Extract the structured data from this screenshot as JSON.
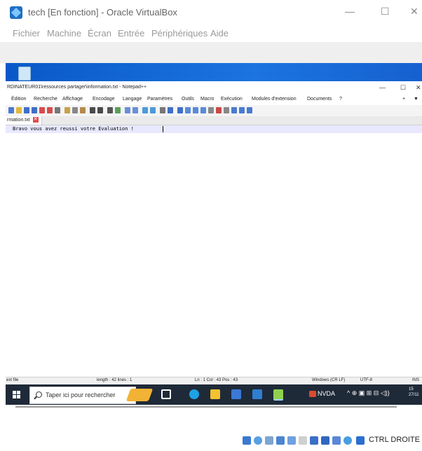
{
  "vbox": {
    "title": "tech [En fonction] - Oracle VirtualBox",
    "minimize": "—",
    "maximize": "☐",
    "close": "✕",
    "menu": [
      "Fichier",
      "Machine",
      "Écran",
      "Entrée",
      "Périphériques",
      "Aide"
    ],
    "host_key": "CTRL DROITE"
  },
  "notepad": {
    "title": "RDINATEUR01\\ressources partager\\information.txt - Notepad++",
    "minimize": "—",
    "maximize": "☐",
    "close": "✕",
    "menu": [
      "Édition",
      "Recherche",
      "Affichage",
      "Encodage",
      "Langage",
      "Paramètres",
      "Outils",
      "Macro",
      "Exécution",
      "Modules d'extension",
      "Documents",
      "?"
    ],
    "menu_extra": [
      "+",
      "▼"
    ],
    "tab": {
      "label": "rmation.txt",
      "close": "✕"
    },
    "content": "Bravo vous avez reussi votre Evaluation !",
    "status": {
      "type": "ext file",
      "length": "length : 42   lines : 1",
      "position": "Ln : 1   Col : 43   Pos : 43",
      "eol": "Windows (CR LF)",
      "encoding": "UTF-8",
      "mode": "INS"
    }
  },
  "taskbar": {
    "search_placeholder": "Taper ici pour rechercher",
    "nvda_label": "NVDA",
    "tray": "^ ⊕ ▣ ⊞ ⊟ ◁))",
    "clock_line1": "15",
    "clock_line2": "27/11"
  },
  "colors": {
    "desktop_blue": "#1b74e0",
    "taskbar": "#1f2a38",
    "current_line": "#e8e8ff"
  }
}
